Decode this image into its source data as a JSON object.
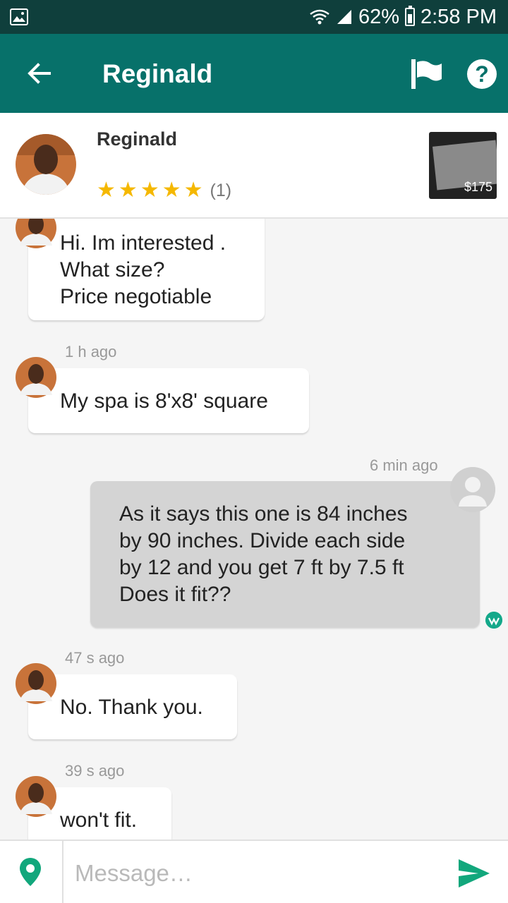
{
  "status_bar": {
    "battery": "62%",
    "time": "2:58 PM",
    "icons": [
      "gallery-icon",
      "wifi-icon",
      "signal-icon",
      "battery-icon"
    ]
  },
  "app_bar": {
    "title": "Reginald",
    "icons": [
      "back-arrow-icon",
      "flag-icon",
      "help-icon"
    ],
    "help_glyph": "?"
  },
  "seller": {
    "name": "Reginald",
    "rating_stars": 5,
    "review_count": "(1)",
    "star_glyph": "★"
  },
  "product": {
    "price": "$175"
  },
  "messages": [
    {
      "from": "them",
      "time": "",
      "lines": [
        "Hi. Im interested .",
        "What size?",
        "Price negotiable"
      ]
    },
    {
      "from": "them",
      "time": "1 h ago",
      "lines": [
        "My spa is 8'x8' square"
      ]
    },
    {
      "from": "me",
      "time": "6 min ago",
      "lines": [
        "As it says this one is 84 inches",
        "by 90 inches. Divide each side",
        "by 12 and you get 7 ft by 7.5 ft",
        "Does it fit??"
      ]
    },
    {
      "from": "them",
      "time": "47 s ago",
      "lines": [
        "No. Thank you."
      ]
    },
    {
      "from": "them",
      "time": "39 s ago",
      "lines": [
        "won't fit."
      ]
    }
  ],
  "composer": {
    "placeholder": "Message…",
    "icons": [
      "location-pin-icon",
      "send-icon"
    ]
  },
  "colors": {
    "status_bar": "#0f3f3c",
    "app_bar": "#07716a",
    "star": "#f5b800",
    "accent_green": "#14a88a",
    "my_bubble": "#d4d4d4"
  }
}
